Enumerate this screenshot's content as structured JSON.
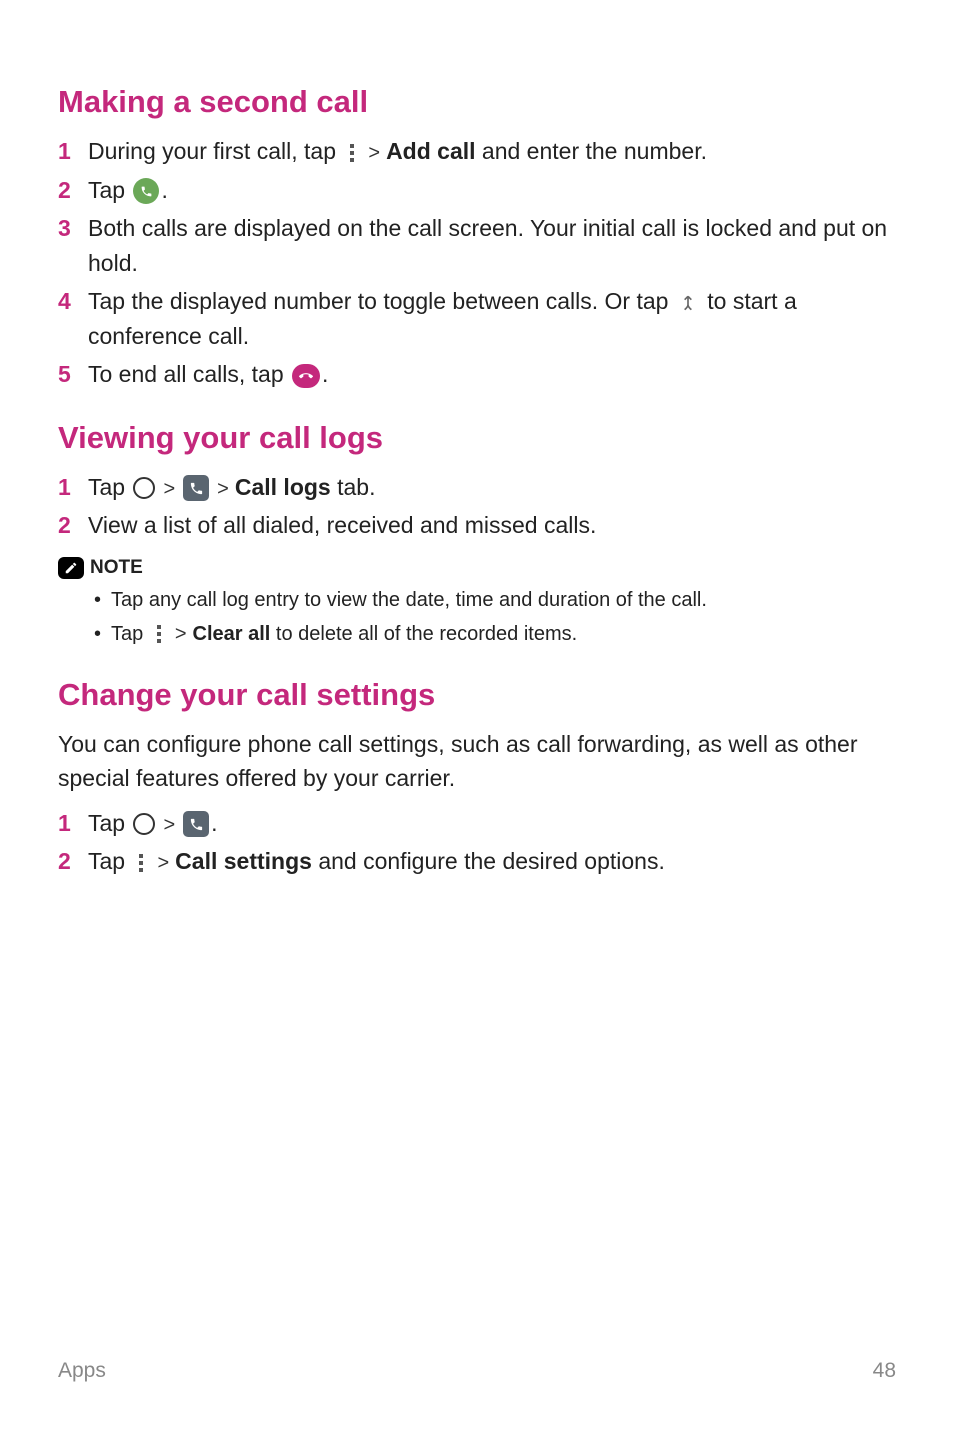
{
  "sections": {
    "making_second_call": {
      "title": "Making a second call",
      "steps": [
        {
          "num": "1",
          "pre": "During your first call, tap ",
          "bold": "Add call",
          "post": " and enter the number."
        },
        {
          "num": "2",
          "pre": "Tap ",
          "post": "."
        },
        {
          "num": "3",
          "text": "Both calls are displayed on the call screen. Your initial call is locked and put on hold."
        },
        {
          "num": "4",
          "pre": "Tap the displayed number to toggle between calls. Or tap ",
          "post": " to start a conference call."
        },
        {
          "num": "5",
          "pre": "To end all calls, tap ",
          "post": "."
        }
      ]
    },
    "viewing_call_logs": {
      "title": "Viewing your call logs",
      "steps": [
        {
          "num": "1",
          "pre": "Tap ",
          "bold": "Call logs",
          "post": " tab."
        },
        {
          "num": "2",
          "text": "View a list of all dialed, received and missed calls."
        }
      ],
      "note_label": "NOTE",
      "notes": [
        {
          "text": "Tap any call log entry to view the date, time and duration of the call."
        },
        {
          "pre": "Tap ",
          "bold": "Clear all",
          "post": " to delete all of the recorded items."
        }
      ]
    },
    "change_call_settings": {
      "title": "Change your call settings",
      "intro": "You can configure phone call settings, such as call forwarding, as well as other special features offered by your carrier.",
      "steps": [
        {
          "num": "1",
          "pre": "Tap ",
          "post": "."
        },
        {
          "num": "2",
          "pre": "Tap ",
          "bold": "Call settings",
          "post": " and configure the desired options."
        }
      ]
    }
  },
  "footer": {
    "section": "Apps",
    "page": "48"
  },
  "chevron": ">"
}
